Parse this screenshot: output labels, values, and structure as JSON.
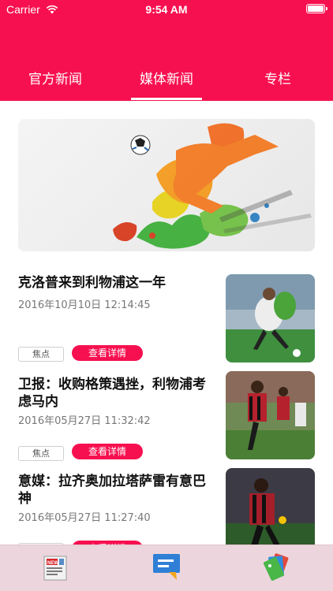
{
  "status_bar": {
    "carrier": "Carrier",
    "time": "9:54 AM"
  },
  "tabs": [
    {
      "label": "官方新闻",
      "selected": false
    },
    {
      "label": "媒体新闻",
      "selected": true
    },
    {
      "label": "专栏",
      "selected": false
    }
  ],
  "news": [
    {
      "title": "克洛普来到利物浦这一年",
      "date": "2016年10月10日 12:14:45",
      "tag": "焦点",
      "button": "查看详情"
    },
    {
      "title": "卫报：收购格策遇挫，利物浦考虑马内",
      "date": "2016年05月27日 11:32:42",
      "tag": "焦点",
      "button": "查看详情"
    },
    {
      "title": "意媒：拉齐奥加拉塔萨雷有意巴神",
      "date": "2016年05月27日 11:27:40",
      "tag": "焦点",
      "button": "查看详情"
    }
  ],
  "tabbar": [
    {
      "icon": "news-paper-icon"
    },
    {
      "icon": "chat-message-icon"
    },
    {
      "icon": "cards-icon"
    }
  ],
  "colors": {
    "accent": "#f7104f",
    "tabbar": "#ecd5dc"
  }
}
